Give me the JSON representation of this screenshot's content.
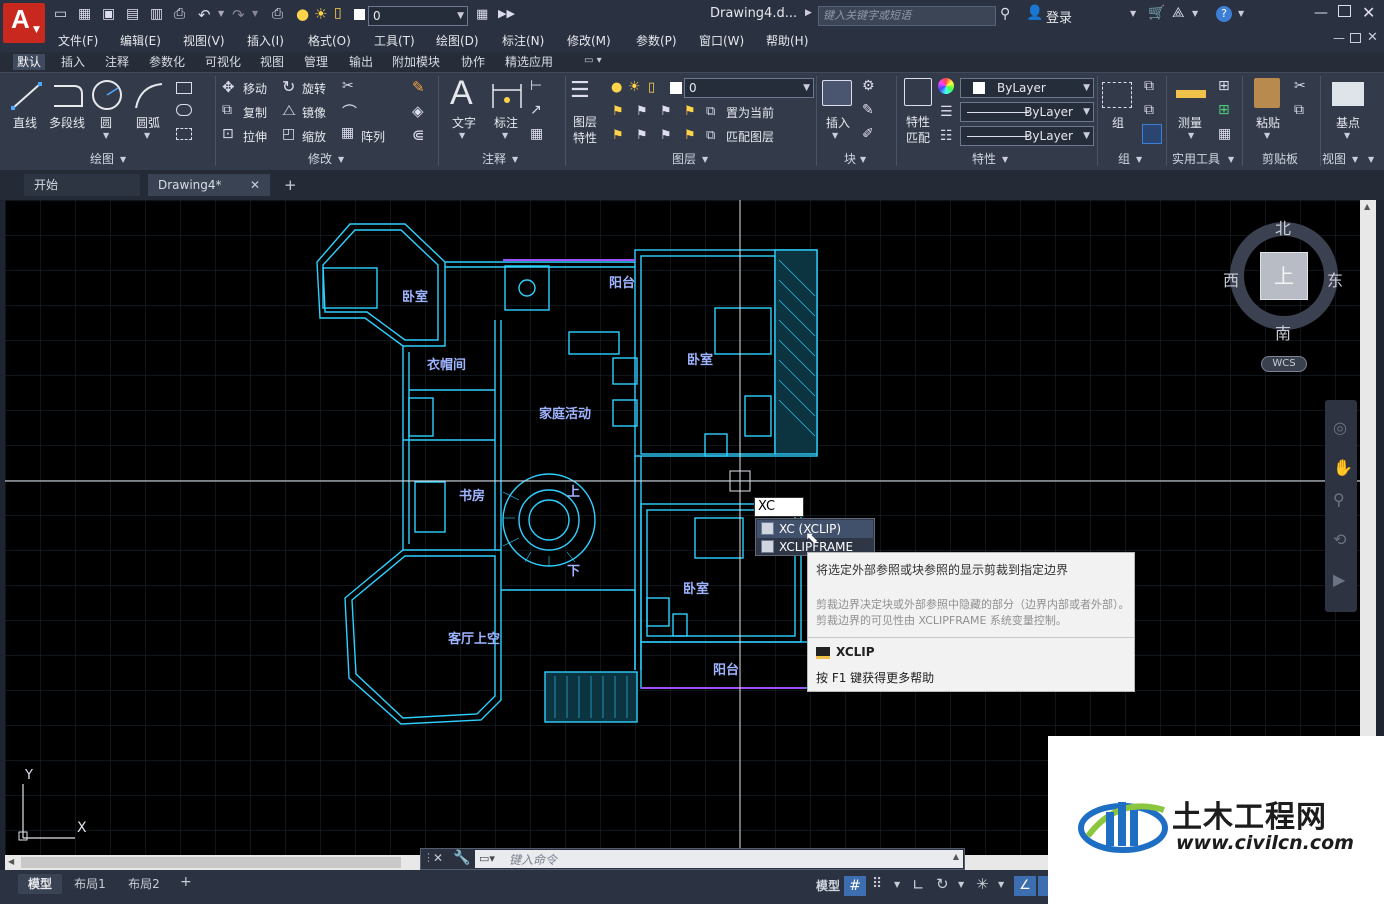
{
  "title": {
    "doc": "Drawing4.d...",
    "search_placeholder": "键入关键字或短语",
    "login": "登录",
    "layer_value": "0"
  },
  "menu": [
    "文件(F)",
    "编辑(E)",
    "视图(V)",
    "插入(I)",
    "格式(O)",
    "工具(T)",
    "绘图(D)",
    "标注(N)",
    "修改(M)",
    "参数(P)",
    "窗口(W)",
    "帮助(H)"
  ],
  "ribbon_tabs": [
    "默认",
    "插入",
    "注释",
    "参数化",
    "可视化",
    "视图",
    "管理",
    "输出",
    "附加模块",
    "协作",
    "精选应用"
  ],
  "draw_tools": {
    "line": "直线",
    "polyline": "多段线",
    "circle": "圆",
    "arc": "圆弧",
    "panel": "绘图"
  },
  "modify_tools": {
    "move": "移动",
    "rotate": "旋转",
    "copy": "复制",
    "mirror": "镜像",
    "stretch": "拉伸",
    "scale": "缩放",
    "array": "阵列",
    "panel": "修改"
  },
  "annotation": {
    "text": "文字",
    "dim": "标注",
    "panel": "注释"
  },
  "layers": {
    "props": "图层\n特性",
    "set_current": "置为当前",
    "match": "匹配图层",
    "value": "0",
    "panel": "图层"
  },
  "block": {
    "insert": "插入",
    "panel": "块"
  },
  "properties": {
    "match": "特性\n匹配",
    "color": "ByLayer",
    "linetype": "ByLayer",
    "lineweight": "ByLayer",
    "panel": "特性"
  },
  "group": {
    "label": "组",
    "panel": "组"
  },
  "utilities": {
    "measure": "测量",
    "panel": "实用工具"
  },
  "clipboard": {
    "paste": "粘贴",
    "panel": "剪贴板"
  },
  "view": {
    "base": "基点",
    "panel": "视图"
  },
  "doc_tabs": [
    "开始",
    "Drawing4*"
  ],
  "rooms": [
    "卧室",
    "阳台",
    "衣帽间",
    "家庭活动",
    "卧室",
    "书房",
    "上",
    "下",
    "卧室",
    "客厅上空",
    "阳台"
  ],
  "viewcube": {
    "north": "北",
    "south": "南",
    "east": "东",
    "west": "西",
    "top": "上",
    "wcs": "WCS"
  },
  "axis": {
    "y": "Y",
    "x": "X"
  },
  "command": {
    "typed": "XC",
    "placeholder": "键入命令"
  },
  "autocomplete": [
    "XC (XCLIP)",
    "XCLIPFRAME"
  ],
  "tooltip": {
    "desc": "将选定外部参照或块参照的显示剪裁到指定边界",
    "detail": "剪裁边界决定块或外部参照中隐藏的部分（边界内部或者外部）。剪裁边界的可见性由 XCLIPFRAME 系统变量控制。",
    "cmd": "XCLIP",
    "help": "按 F1 键获得更多帮助"
  },
  "layout_tabs": [
    "模型",
    "布局1",
    "布局2"
  ],
  "status": {
    "model": "模型"
  },
  "watermark": {
    "name": "土木工程网",
    "url": "www.civilcn.com"
  },
  "colors": {
    "accent": "#c8281e",
    "plan_cyan": "#2fd0ff",
    "plan_violet": "#a050ff",
    "text_blue": "#9fb4ff"
  }
}
